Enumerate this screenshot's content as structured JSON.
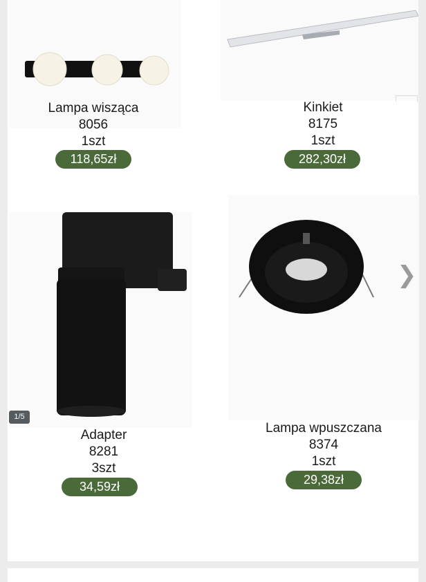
{
  "products": [
    {
      "name": "Lampa wisząca",
      "code": "8056",
      "qty": "1szt",
      "price": "118,65zł",
      "icon": "pendant-lamp-image"
    },
    {
      "name": "Kinkiet",
      "code": "8175",
      "qty": "1szt",
      "price": "282,30zł",
      "icon": "wall-light-bar-image"
    },
    {
      "name": "Adapter",
      "code": "8281",
      "qty": "3szt",
      "price": "34,59zł",
      "icon": "track-adapter-image"
    },
    {
      "name": "Lampa wpuszczana",
      "code": "8374",
      "qty": "1szt",
      "price": "29,38zł",
      "icon": "recessed-downlight-image"
    }
  ],
  "gallery": {
    "counter": "1/5",
    "next_icon": "chevron-right-icon"
  },
  "colors": {
    "price_badge": "#4b6a3a",
    "background": "#ececec",
    "card": "#ffffff"
  }
}
